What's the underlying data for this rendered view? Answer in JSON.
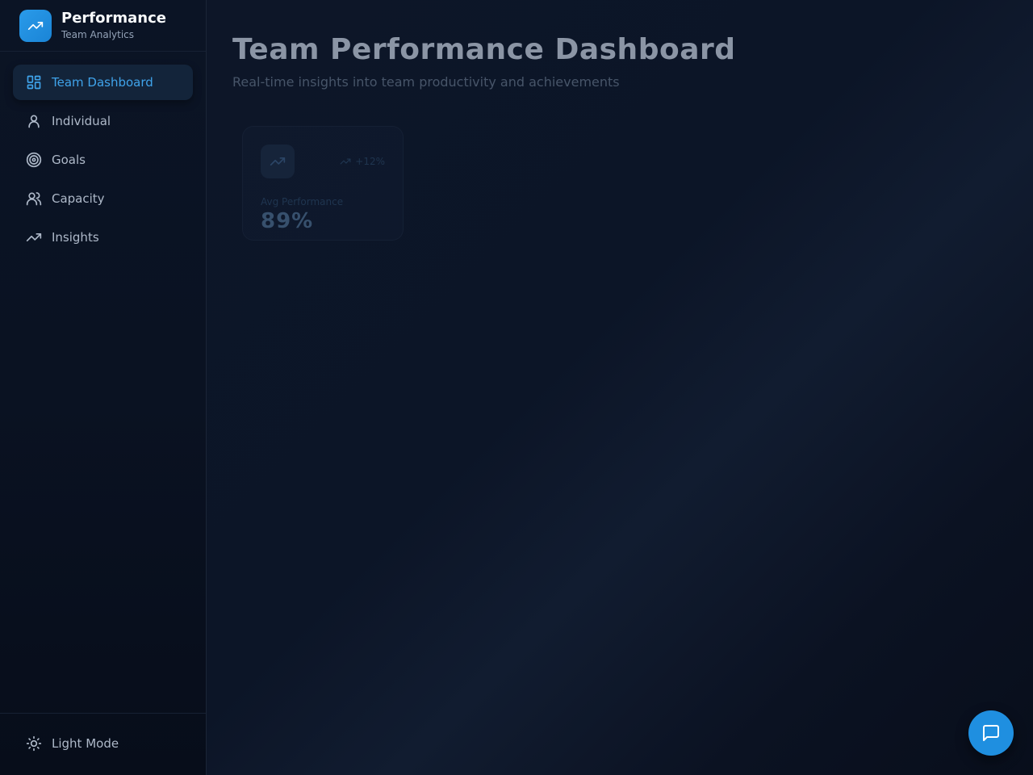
{
  "brand": {
    "title": "Performance",
    "subtitle": "Team Analytics",
    "icon": "trending-up-icon",
    "color": "#1f8fe0"
  },
  "nav": {
    "items": [
      {
        "label": "Team Dashboard",
        "icon": "layout-grid-icon",
        "active": true
      },
      {
        "label": "Individual",
        "icon": "user-icon",
        "active": false
      },
      {
        "label": "Goals",
        "icon": "target-icon",
        "active": false
      },
      {
        "label": "Capacity",
        "icon": "users-icon",
        "active": false
      },
      {
        "label": "Insights",
        "icon": "trending-up-icon",
        "active": false
      }
    ]
  },
  "footer": {
    "theme_toggle_label": "Light Mode",
    "icon": "sun-icon"
  },
  "main": {
    "title": "Team Performance Dashboard",
    "subtitle": "Real-time insights into team productivity and achievements",
    "stat_card": {
      "label": "Avg Performance",
      "value": "89%",
      "trend": "+12%",
      "icon": "trending-up-icon"
    }
  },
  "chat_button": {
    "icon": "message-square-icon"
  },
  "colors": {
    "accent": "#3fa3ea",
    "background": "#0a1120"
  }
}
